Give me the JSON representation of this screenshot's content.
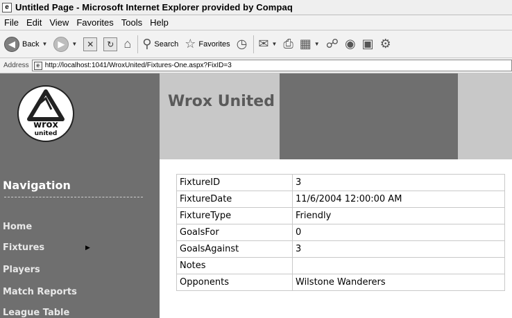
{
  "window": {
    "title": "Untitled Page - Microsoft Internet Explorer provided by Compaq"
  },
  "menu": [
    "File",
    "Edit",
    "View",
    "Favorites",
    "Tools",
    "Help"
  ],
  "toolbar": {
    "back_label": "Back",
    "search_label": "Search",
    "favorites_label": "Favorites"
  },
  "address": {
    "label": "Address",
    "url": "http://localhost:1041/WroxUnited/Fixtures-One.aspx?FixID=3"
  },
  "site": {
    "title": "Wrox United",
    "logo_text_1": "wrox",
    "logo_text_2": "united"
  },
  "nav": {
    "heading": "Navigation",
    "items": [
      "Home",
      "Fixtures",
      "Players",
      "Match Reports",
      "League Table"
    ]
  },
  "fixture": {
    "rows": [
      {
        "field": "FixtureID",
        "value": "3"
      },
      {
        "field": "FixtureDate",
        "value": "11/6/2004 12:00:00 AM"
      },
      {
        "field": "FixtureType",
        "value": "Friendly"
      },
      {
        "field": "GoalsFor",
        "value": "0"
      },
      {
        "field": "GoalsAgainst",
        "value": "3"
      },
      {
        "field": "Notes",
        "value": ""
      },
      {
        "field": "Opponents",
        "value": "Wilstone Wanderers"
      }
    ]
  },
  "colors": {
    "sidebar_bg": "#6f6f6f",
    "header_light": "#c8c8c8",
    "site_title": "#5a5a5a"
  }
}
